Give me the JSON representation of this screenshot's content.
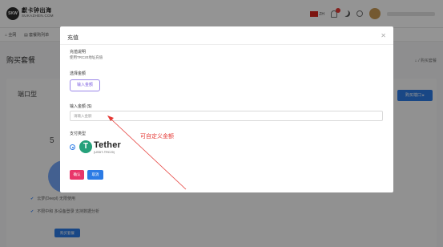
{
  "topbar": {
    "logo_mark": "SKW",
    "logo_title": "獻卡钟出海",
    "logo_subtitle": "SUKAZHEN.COM",
    "language": "ZH",
    "colors": {
      "accent": "#2c7be5",
      "flag": "#d6251c"
    }
  },
  "subnav": {
    "items": [
      {
        "label": "全网",
        "icon": "home-icon"
      },
      {
        "label": "套餐购列单",
        "icon": "list-icon"
      }
    ]
  },
  "page": {
    "title": "购买套餐",
    "breadcrumb": "⌂ / 购买套餐"
  },
  "background_card": {
    "title": "端口型",
    "buy_top_label": "购买端口 ▸",
    "price_prefix": "5",
    "features": [
      "云梦(Deepl) 无限使用",
      "不限中和 多设备登录 支持数据分析"
    ],
    "buy_bottom_label": "购买套餐"
  },
  "modal": {
    "title": "充值",
    "close_icon": "close-icon",
    "recharge_note_label": "充值说明",
    "recharge_note_text": "使用TRC20地址充值",
    "select_amount_label": "选择金额",
    "amount_option": "输入金额",
    "input_amount_label": "输入金额 ($)",
    "input_placeholder": "请输入金额",
    "payment_type_label": "支付类型",
    "payment_name": "Tether",
    "payment_sub": "(USDT-TRC20)",
    "confirm_label": "确认",
    "cancel_label": "取消",
    "colors": {
      "confirm": "#e8366a",
      "cancel": "#2c7be5",
      "tether": "#26a17b"
    }
  },
  "annotation": {
    "text": "可自定义金额",
    "color": "#e53935"
  }
}
